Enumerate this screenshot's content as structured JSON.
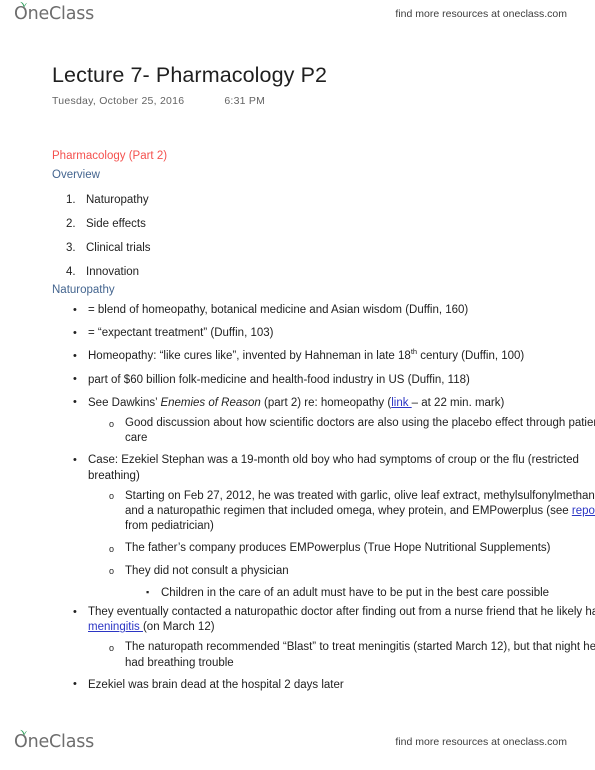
{
  "branding": {
    "logo_text": "OneClass",
    "logo_icon": "leaf-sprout-icon",
    "tagline": "find more resources at oneclass.com",
    "leaf_color": "#2e9e5b",
    "logo_color": "#6e6e6e"
  },
  "document": {
    "title": "Lecture 7- Pharmacology P2",
    "date": "Tuesday,  October 25, 2016",
    "time": "6:31 PM"
  },
  "headings": {
    "topic": "Pharmacology (Part 2)",
    "topic_color": "#f4514e",
    "overview": "Overview",
    "naturopathy": "Naturopathy",
    "heading_color": "#44658f"
  },
  "overview_items": [
    "Naturopathy",
    "Side effects",
    "Clinical trials",
    "Innovation"
  ],
  "naturopathy_notes": {
    "b1_blend": "= blend of homeopathy, botanical medicine and Asian wisdom (Duffin, 160)",
    "b2_expectant": "= “expectant treatment” (Duffin, 103)",
    "b3_homeopathy_pre": "Homeopathy: “like cures like”, invented by Hahneman in late 18",
    "b3_homeopathy_sup": "th",
    "b3_homeopathy_post": " century (Duffin, 100)",
    "b4_industry": "part of $60 billion folk-medicine and health-food industry in US (Duffin, 118)",
    "b5_dawkins_pre": "See Dawkins’ ",
    "b5_dawkins_italic": "Enemies of Reason",
    "b5_dawkins_mid": " (part 2) re: homeopathy (",
    "b5_dawkins_link": "link ",
    "b5_dawkins_post": "– at 22 min. mark)",
    "b5_sub_placebo": "Good discussion about how scientific doctors are also using the placebo effect through patient care",
    "b6_case": "Case: Ezekiel Stephan was a 19-month old boy who had symptoms of croup or the flu (restricted breathing)",
    "b6_sub_treatment_pre": "Starting on Feb 27, 2012, he was treated with garlic, olive leaf extract, methylsulfonylmethane, and a naturopathic regimen that included omega, whey protein, and EMPowerplus (see ",
    "b6_sub_treatment_link": "report",
    "b6_sub_treatment_post": " from pediatrician)",
    "b6_sub_company": "The father’s company produces EMPowerplus (True Hope Nutritional Supplements)",
    "b6_sub_physician": "They did not consult a physician",
    "b6_subsub_children": "Children in the care of an adult must have to be put in the best care possible",
    "b7_contacted_pre": "They eventually contacted a naturopathic doctor after finding out from a nurse friend that he likely had ",
    "b7_contacted_link": "meningitis ",
    "b7_contacted_post": "(on March 12)",
    "b7_sub_blast": "The naturopath recommended “Blast” to treat meningitis (started March 12), but that night he had breathing trouble",
    "b8_braindead": "Ezekiel was brain dead at the hospital 2 days later"
  },
  "colors": {
    "link": "#2b35c4",
    "body_text": "#1f1f1f",
    "meta_text": "#646464",
    "page_background": "#ffffff"
  }
}
